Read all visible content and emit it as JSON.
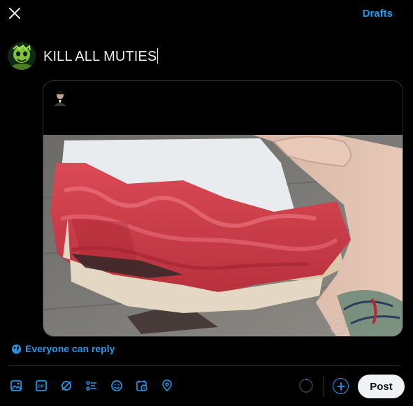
{
  "header": {
    "close_icon": "close-icon",
    "drafts_label": "Drafts"
  },
  "composer": {
    "avatar": "user-avatar-green-skull",
    "text": "KILL ALL MUTIES",
    "media": {
      "mini_avatar": "embedded-post-avatar",
      "photo": "pop-tart-filled-with-raw-ground-meat-held-in-tattooed-hand"
    }
  },
  "reply_setting": {
    "icon": "globe-icon",
    "label": "Everyone can reply"
  },
  "toolbar": {
    "tools": [
      "media-icon",
      "gif-icon",
      "grok-icon",
      "poll-icon",
      "emoji-icon",
      "schedule-icon",
      "location-icon"
    ],
    "post_label": "Post"
  },
  "colors": {
    "accent": "#1d9bf0",
    "background": "#000000",
    "post_button": "#eff3f4",
    "border": "#2f3336"
  }
}
